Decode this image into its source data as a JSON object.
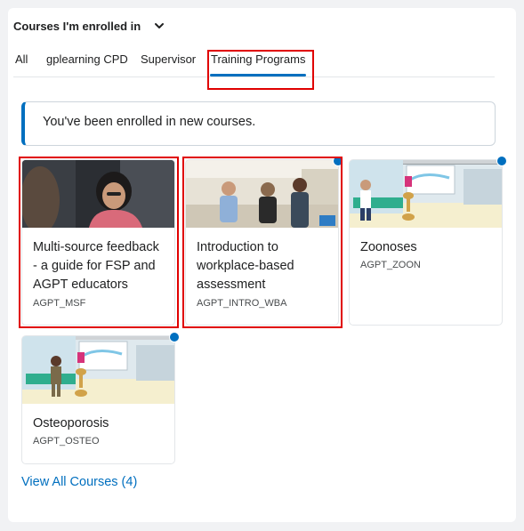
{
  "header": {
    "title": "Courses I'm enrolled in"
  },
  "tabs": [
    {
      "label": "All"
    },
    {
      "label": "gplearning CPD"
    },
    {
      "label": "Supervisor"
    },
    {
      "label": "Training Programs",
      "selected": true
    }
  ],
  "alert": {
    "text": "You've been enrolled in new courses."
  },
  "courses": [
    {
      "title": "Multi-source feedback - a guide for FSP and AGPT educators",
      "code": "AGPT_MSF",
      "new": false
    },
    {
      "title": "Introduction to workplace-based assessment",
      "code": "AGPT_INTRO_WBA",
      "new": true
    },
    {
      "title": "Zoonoses",
      "code": "AGPT_ZOON",
      "new": true
    },
    {
      "title": "Osteoporosis",
      "code": "AGPT_OSTEO",
      "new": true
    }
  ],
  "view_all": {
    "label": "View All Courses (4)"
  },
  "colors": {
    "accent": "#006fbf",
    "highlight": "#e00000",
    "new_dot": "#006fbf"
  },
  "icons": {
    "dropdown": "chevron-down-icon"
  }
}
